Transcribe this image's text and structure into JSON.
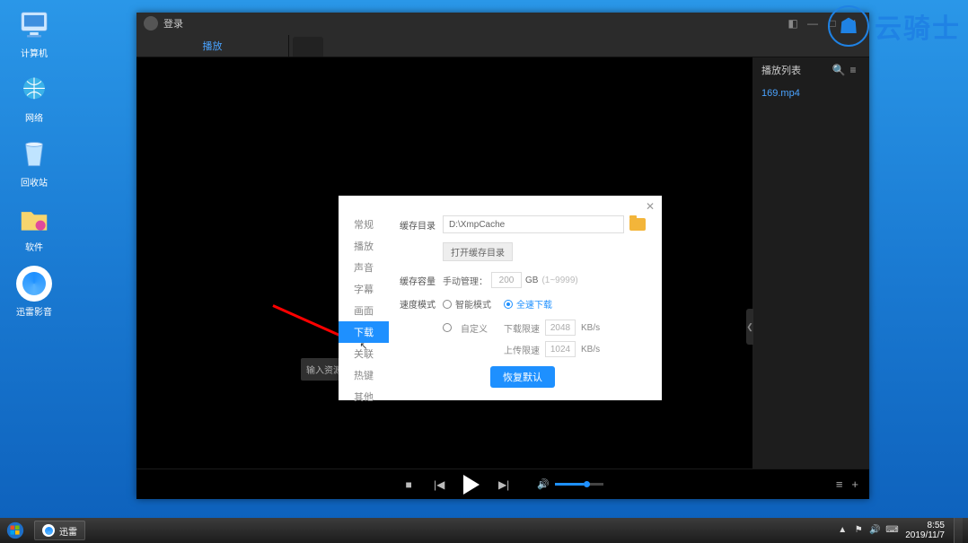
{
  "desktop": {
    "items": [
      {
        "label": "计算机",
        "icon": "computer"
      },
      {
        "label": "网络",
        "icon": "network"
      },
      {
        "label": "回收站",
        "icon": "recycle"
      },
      {
        "label": "软件",
        "icon": "folder"
      },
      {
        "label": "迅雷影音",
        "icon": "xunlei"
      }
    ]
  },
  "watermark": {
    "text": "云骑士",
    "glyph": "☗"
  },
  "player": {
    "login": "登录",
    "win_buttons": {
      "skin": "◧",
      "min": "—",
      "max": "□",
      "close": "✕"
    },
    "tab_active": "播放",
    "playlist_header": "播放列表",
    "playlist_items": [
      "169.mp4"
    ],
    "search_placeholder": "输入资源链接",
    "controls": {
      "stop": "■",
      "prev": "|◀",
      "next": "▶|",
      "vol": "🔊"
    },
    "right_controls": {
      "list": "≡",
      "add": "+"
    }
  },
  "dialog": {
    "nav": [
      "常规",
      "播放",
      "声音",
      "字幕",
      "画面",
      "下载",
      "关联",
      "热键",
      "其他"
    ],
    "nav_active_index": 5,
    "rows": {
      "cache_dir_label": "缓存目录",
      "cache_dir_value": "D:\\XmpCache",
      "open_dir_btn": "打开缓存目录",
      "cache_cap_label": "缓存容量",
      "manual_mgmt": "手动管理：",
      "cap_value": "200",
      "cap_unit": "GB",
      "cap_range": "(1~9999)",
      "speed_mode_label": "速度模式",
      "smart_mode": "智能模式",
      "full_speed": "全速下载",
      "custom": "自定义",
      "dl_limit_label": "下载限速",
      "dl_limit_value": "2048",
      "ul_limit_label": "上传限速",
      "ul_limit_value": "1024",
      "unit_kbs": "KB/s",
      "restore_btn": "恢复默认"
    }
  },
  "taskbar": {
    "app": "迅雷",
    "tray": [
      "▲",
      "⚑",
      "🔊",
      "⌨"
    ],
    "time": "8:55",
    "date": "2019/11/7"
  }
}
